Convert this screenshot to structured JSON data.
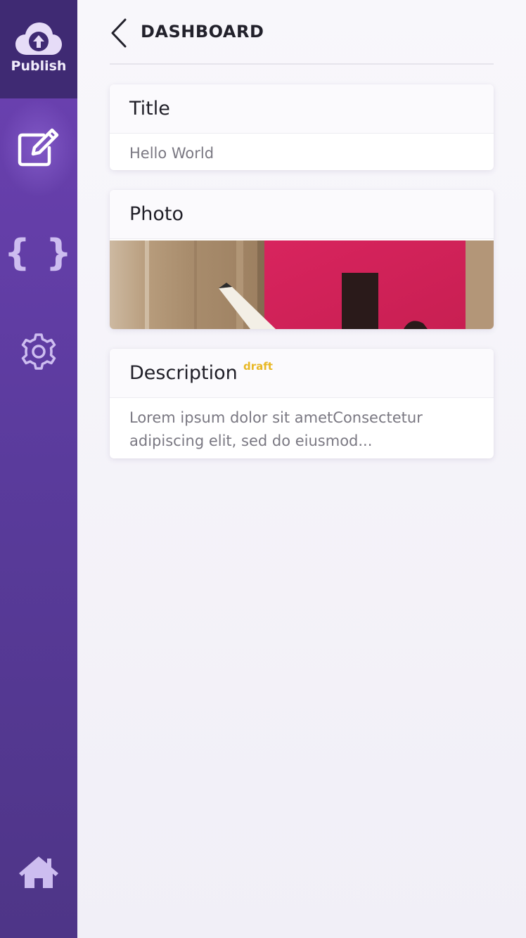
{
  "sidebar": {
    "publish": {
      "label": "Publish",
      "icon": "cloud-upload-icon"
    },
    "items": [
      {
        "icon": "edit-icon",
        "active": true
      },
      {
        "icon": "braces-icon",
        "glyph": "{ }",
        "active": false
      },
      {
        "icon": "gear-icon",
        "active": false
      },
      {
        "icon": "home-icon",
        "active": false
      }
    ]
  },
  "header": {
    "title": "DASHBOARD"
  },
  "cards": {
    "title": {
      "label": "Title",
      "value": "Hello World"
    },
    "photo": {
      "label": "Photo"
    },
    "description": {
      "label": "Description",
      "badge": "draft",
      "value": "Lorem ipsum dolor sit ametConsectetur adipiscing elit, sed do eiusmod..."
    }
  },
  "colors": {
    "sidebar_top": "#3f2a73",
    "sidebar_gradient_start": "#6d41b3",
    "sidebar_gradient_end": "#4e3587",
    "draft_badge": "#e8b826",
    "photo_pink": "#d9265f"
  }
}
